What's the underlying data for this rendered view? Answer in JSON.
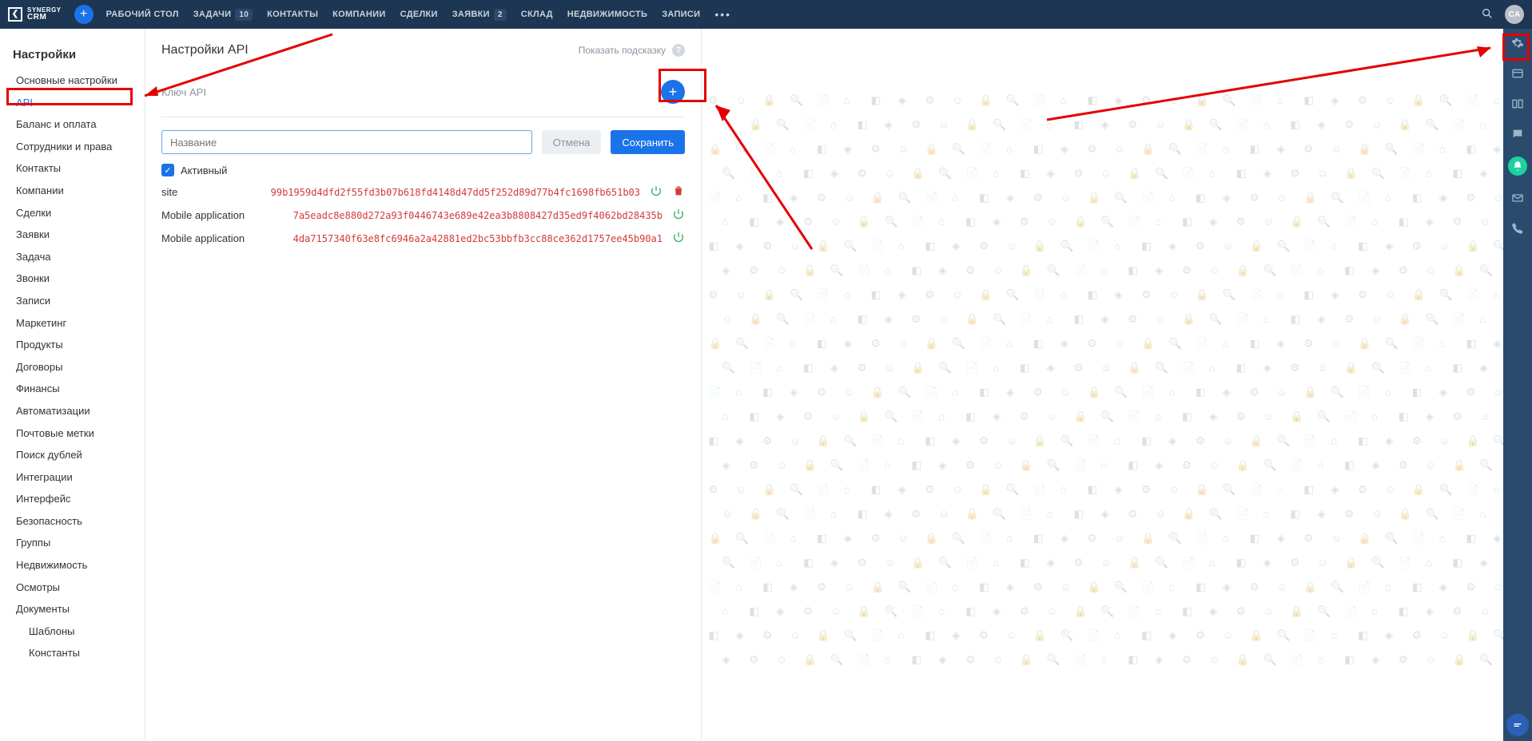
{
  "header": {
    "logo_top": "SYNERGY",
    "logo_bottom": "CRM",
    "nav": [
      {
        "label": "РАБОЧИЙ СТОЛ"
      },
      {
        "label": "ЗАДАЧИ",
        "badge": "10"
      },
      {
        "label": "КОНТАКТЫ"
      },
      {
        "label": "КОМПАНИИ"
      },
      {
        "label": "СДЕЛКИ"
      },
      {
        "label": "ЗАЯВКИ",
        "badge": "2"
      },
      {
        "label": "СКЛАД"
      },
      {
        "label": "НЕДВИЖИМОСТЬ"
      },
      {
        "label": "ЗАПИСИ"
      }
    ],
    "avatar_initials": "CA"
  },
  "sidebar": {
    "title": "Настройки",
    "items": [
      {
        "label": "Основные настройки"
      },
      {
        "label": "API",
        "active": true
      },
      {
        "label": "Баланс и оплата"
      },
      {
        "label": "Сотрудники и права"
      },
      {
        "label": "Контакты"
      },
      {
        "label": "Компании"
      },
      {
        "label": "Сделки"
      },
      {
        "label": "Заявки"
      },
      {
        "label": "Задача"
      },
      {
        "label": "Звонки"
      },
      {
        "label": "Записи"
      },
      {
        "label": "Маркетинг"
      },
      {
        "label": "Продукты"
      },
      {
        "label": "Договоры"
      },
      {
        "label": "Финансы"
      },
      {
        "label": "Автоматизации"
      },
      {
        "label": "Почтовые метки"
      },
      {
        "label": "Поиск дублей"
      },
      {
        "label": "Интеграции"
      },
      {
        "label": "Интерфейс"
      },
      {
        "label": "Безопасность"
      },
      {
        "label": "Группы"
      },
      {
        "label": "Недвижимость"
      },
      {
        "label": "Осмотры"
      },
      {
        "label": "Документы"
      }
    ],
    "sub_items": [
      {
        "label": "Шаблоны"
      },
      {
        "label": "Константы"
      }
    ]
  },
  "main": {
    "page_title": "Настройки API",
    "hint_label": "Показать подсказку",
    "section_title": "Ключ API",
    "input_placeholder": "Название",
    "btn_cancel": "Отмена",
    "btn_save": "Сохранить",
    "active_label": "Активный",
    "keys": [
      {
        "name": "site",
        "value": "99b1959d4dfd2f55fd3b07b618fd4148d47dd5f252d89d77b4fc1698fb651b03",
        "deletable": true
      },
      {
        "name": "Mobile application",
        "value": "7a5eadc8e880d272a93f0446743e689e42ea3b8808427d35ed9f4062bd28435b",
        "deletable": false
      },
      {
        "name": "Mobile application",
        "value": "4da7157340f63e8fc6946a2a42881ed2bc53bbfb3cc88ce362d1757ee45b90a1",
        "deletable": false
      }
    ]
  }
}
